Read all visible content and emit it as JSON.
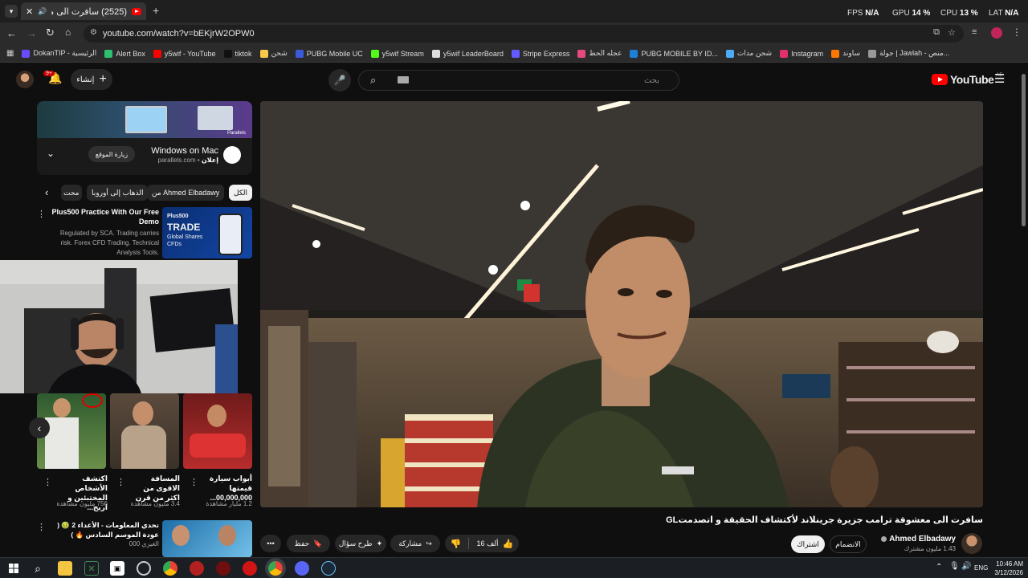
{
  "browser": {
    "tab_title": "(2525) سافرت الى معشوقة...",
    "new_tab": "+",
    "url": "youtube.com/watch?v=bEKjrW2OPW0",
    "perf": {
      "fps_label": "FPS",
      "fps_value": "N/A",
      "gpu_label": "GPU",
      "gpu_value": "14 %",
      "cpu_label": "CPU",
      "cpu_value": "13 %",
      "lat_label": "LAT",
      "lat_value": "N/A"
    },
    "bookmarks": [
      {
        "label": "DokanTIP - الرئيسية",
        "color": "#6a4cff"
      },
      {
        "label": "Alert Box",
        "color": "#2fbf71"
      },
      {
        "label": "y5wif - YouTube",
        "color": "#ff0000"
      },
      {
        "label": "tiktok",
        "color": "#111111"
      },
      {
        "label": "شحن",
        "color": "#f7c948"
      },
      {
        "label": "PUBG Mobile UC",
        "color": "#3b5bdb"
      },
      {
        "label": "y5wif Stream",
        "color": "#53fc18"
      },
      {
        "label": "y5wif LeaderBoard",
        "color": "#dddddd"
      },
      {
        "label": "Stripe Express",
        "color": "#635bff"
      },
      {
        "label": "عجله الحظ",
        "color": "#e64980"
      },
      {
        "label": "PUBG MOBILE BY ID...",
        "color": "#1c7ed6"
      },
      {
        "label": "شحن مدات",
        "color": "#4dabf7"
      },
      {
        "label": "Instagram",
        "color": "#e1306c"
      },
      {
        "label": "ساوند",
        "color": "#ff7700"
      },
      {
        "label": "جولة | Jawlah - منص...",
        "color": "#999999"
      }
    ]
  },
  "youtube": {
    "logo_text": "YouTube",
    "logo_region": "AE",
    "search_placeholder": "بحث",
    "create_label": "إنشاء",
    "notif_count": "9+"
  },
  "ad": {
    "title": "Windows on Mac",
    "sponsor": "إعلان",
    "domain": "parallels.com",
    "visit": "زيارة الموقع",
    "brand": "Parallels"
  },
  "chips": [
    "الكل",
    "من Ahmed Elbadawy",
    "الذهاب إلى أوروبا",
    "محت"
  ],
  "promo": {
    "title": "Plus500 Practice With Our Free Demo",
    "desc": "Regulated by SCA. Trading carries risk. Forex CFD Trading. Technical Analysis Tools.",
    "thumb_brand": "Plus500",
    "thumb_line1": "TRADE",
    "thumb_line2": "Global Shares",
    "thumb_line3": "CFDs"
  },
  "shorts": [
    {
      "title": "أبواب سيارة قيمتها 00,000,000...",
      "views": "1.2 مليار مشاهدة"
    },
    {
      "title": "المسافة الاقوى من اكثر من قرن",
      "views": "3.4 مليون مشاهدة"
    },
    {
      "title": "اكتشف الأشخاص المختبئين و اربح...",
      "views": "756 مليون مشاهدة"
    }
  ],
  "next_video": {
    "title": "تحدي المعلومات - الأعداء 2 🤢 ( عودة الموسم السادس 🔥 )",
    "channel": "الغيزي 000"
  },
  "video": {
    "title": "سافرت الى معشوقة ترامب جزيرة جرينلاند لأكتشاف الحقيقة و اتصدمتGL",
    "channel": "Ahmed Elbadawy",
    "subs": "1.43 مليون مشترك",
    "join": "الانضمام",
    "subscribe": "اشتراك",
    "likes": "16 ألف",
    "share": "مشاركة",
    "ask": "طرح سؤال",
    "save": "حفظ",
    "more": "•••"
  },
  "taskbar": {
    "time": "10:46 AM",
    "date": "3/12/2026",
    "lang": "ENG"
  }
}
